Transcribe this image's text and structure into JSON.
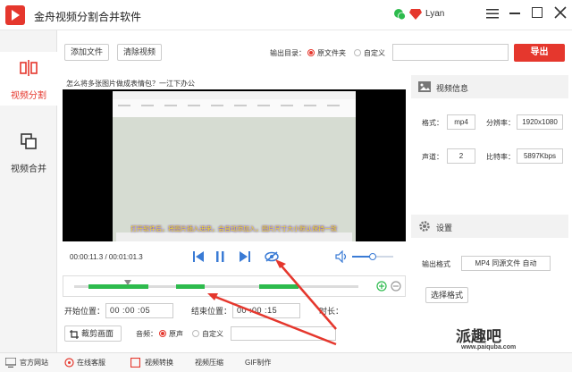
{
  "app": {
    "title": "金舟视频分割合并软件",
    "user": "Lyan",
    "accent_color": "#e5372d",
    "wechat_icon": "wechat-icon",
    "vip_icon": "vip-diamond-icon"
  },
  "sidebar": {
    "items": [
      {
        "label": "视频分割",
        "icon": "split-icon",
        "active": true
      },
      {
        "label": "视频合并",
        "icon": "merge-icon",
        "active": false
      }
    ]
  },
  "toolbar": {
    "add_file": "添加文件",
    "clear_video": "清除视频",
    "output_dir_label": "输出目录：",
    "output_opt_source": "原文件夹",
    "output_opt_custom": "自定义",
    "output_path": "",
    "export": "导出"
  },
  "preview": {
    "video_title": "怎么将多张图片做成表情包？一江下办公",
    "subtitle": "打开软件后，将图片插入进来，会自动添加入，图片尺寸大小默认保持一致",
    "current_time": "00:00:11.3",
    "total_time": "00:01:01.3",
    "volume_level": 0.5
  },
  "timeline": {
    "segments": [
      {
        "start": 0.05,
        "end": 0.26
      },
      {
        "start": 0.36,
        "end": 0.46
      },
      {
        "start": 0.65,
        "end": 0.79
      }
    ],
    "playhead": 0.19
  },
  "times": {
    "start_label": "开始位置：",
    "start": [
      "00",
      "00",
      "05"
    ],
    "end_label": "结束位置：",
    "end": [
      "00",
      "00",
      "15"
    ],
    "duration_label": "时长："
  },
  "crop": {
    "crop_button": "裁剪画面",
    "audio_label": "音频：",
    "audio_opt_original": "原声",
    "audio_opt_custom": "自定义"
  },
  "video_info": {
    "header": "视频信息",
    "format_label": "格式：",
    "format": "mp4",
    "resolution_label": "分辨率：",
    "resolution": "1920x1080",
    "channels_label": "声道：",
    "channels": "2",
    "bitrate_label": "比特率：",
    "bitrate": "5897Kbps"
  },
  "settings": {
    "header": "设置",
    "output_format_label": "输出格式",
    "output_format": "MP4 同源文件 自动",
    "select_format": "选择格式"
  },
  "bottom": {
    "items": [
      "官方网站",
      "在线客服",
      "视频转换",
      "视频压缩",
      "GIF制作"
    ]
  },
  "watermark": {
    "text": "派趣吧",
    "url": "www.paiquba.com"
  }
}
